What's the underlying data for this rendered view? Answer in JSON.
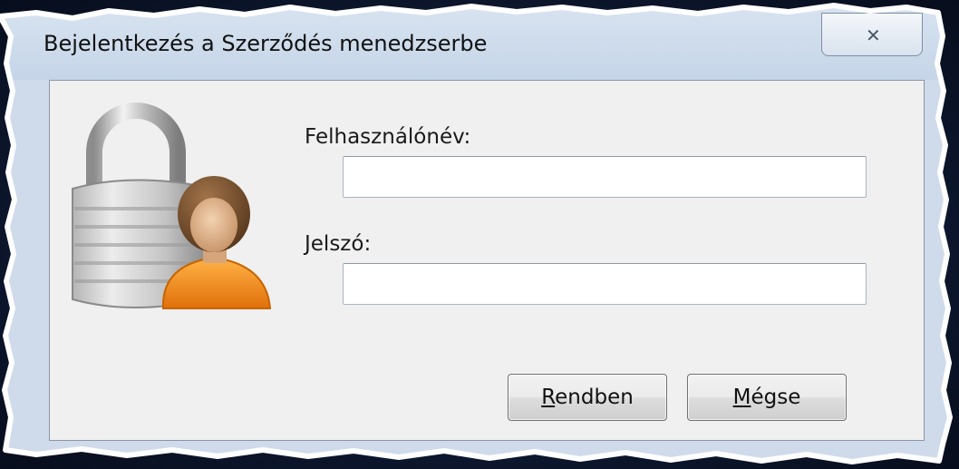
{
  "dialog": {
    "title": "Bejelentkezés a Szerződés menedzserbe",
    "close_glyph": "✕"
  },
  "form": {
    "username_label": "Felhasználónév:",
    "username_value": "",
    "password_label": "Jelszó:",
    "password_value": ""
  },
  "buttons": {
    "ok": {
      "mnemonic": "R",
      "rest": "endben"
    },
    "cancel": {
      "mnemonic": "M",
      "rest": "égse"
    }
  },
  "icon": {
    "name": "lock-user-icon"
  },
  "colors": {
    "titlebar": "#c5d5e8",
    "client": "#f0f0f0",
    "person_shirt": "#f08a1c",
    "person_hair": "#7a5230",
    "lock_body": "#a9a9a9"
  }
}
